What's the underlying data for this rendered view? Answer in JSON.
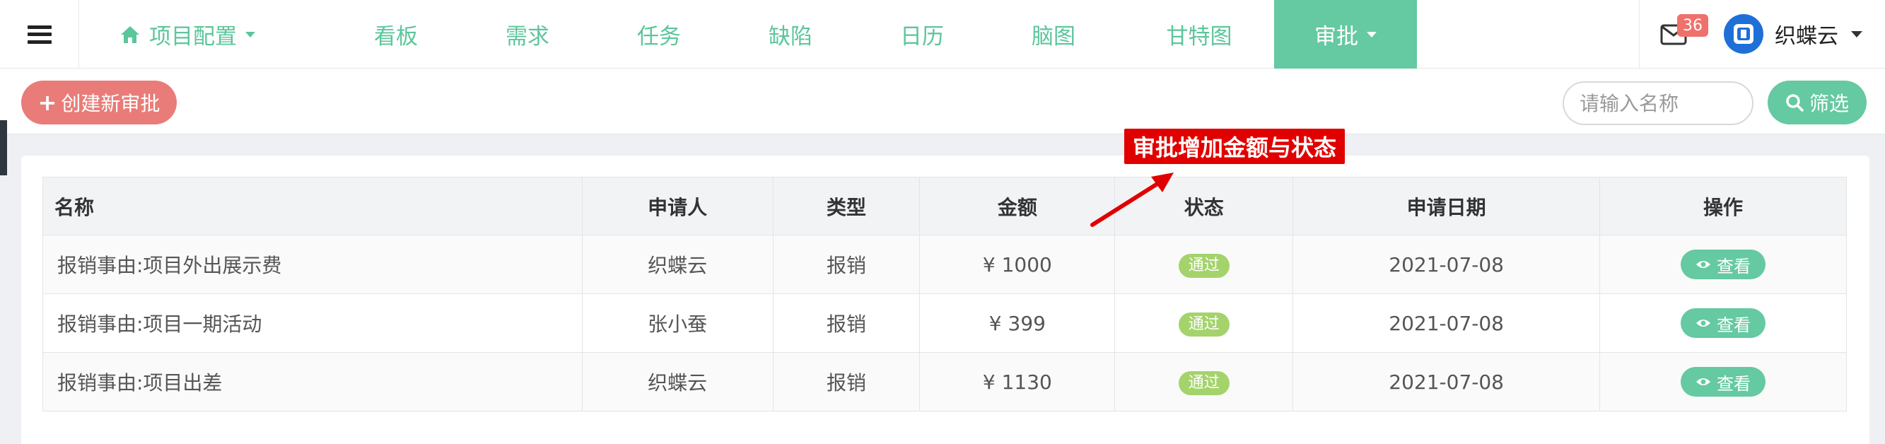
{
  "nav": {
    "items": [
      {
        "label": "项目配置",
        "has_dropdown": true,
        "active": false
      },
      {
        "label": "看板",
        "has_dropdown": false,
        "active": false
      },
      {
        "label": "需求",
        "has_dropdown": false,
        "active": false
      },
      {
        "label": "任务",
        "has_dropdown": false,
        "active": false
      },
      {
        "label": "缺陷",
        "has_dropdown": false,
        "active": false
      },
      {
        "label": "日历",
        "has_dropdown": false,
        "active": false
      },
      {
        "label": "脑图",
        "has_dropdown": false,
        "active": false
      },
      {
        "label": "甘特图",
        "has_dropdown": false,
        "active": false
      },
      {
        "label": "审批",
        "has_dropdown": true,
        "active": true
      }
    ],
    "notification_count": "36",
    "user_name": "织蝶云"
  },
  "toolbar": {
    "create_label": "创建新审批",
    "search_placeholder": "请输入名称",
    "filter_label": "筛选"
  },
  "annotation": {
    "text": "审批增加金额与状态"
  },
  "table": {
    "columns": [
      "名称",
      "申请人",
      "类型",
      "金额",
      "状态",
      "申请日期",
      "操作"
    ],
    "rows": [
      {
        "name": "报销事由:项目外出展示费",
        "applicant": "织蝶云",
        "type": "报销",
        "amount": "¥ 1000",
        "status": "通过",
        "date": "2021-07-08",
        "action": "查看"
      },
      {
        "name": "报销事由:项目一期活动",
        "applicant": "张小蚕",
        "type": "报销",
        "amount": "¥ 399",
        "status": "通过",
        "date": "2021-07-08",
        "action": "查看"
      },
      {
        "name": "报销事由:项目出差",
        "applicant": "织蝶云",
        "type": "报销",
        "amount": "¥ 1130",
        "status": "通过",
        "date": "2021-07-08",
        "action": "查看"
      }
    ]
  },
  "colors": {
    "accent": "#65c9a1",
    "nav_text": "#5cc69b",
    "create_button": "#e97c78",
    "status_pass": "#a4d36b",
    "annotation": "#e00000",
    "badge": "#f0716b"
  },
  "icons": {
    "menu": "hamburger-icon",
    "home": "home-icon",
    "mail": "mail-icon",
    "plus": "plus-icon",
    "search": "search-icon",
    "view": "eye-icon"
  }
}
